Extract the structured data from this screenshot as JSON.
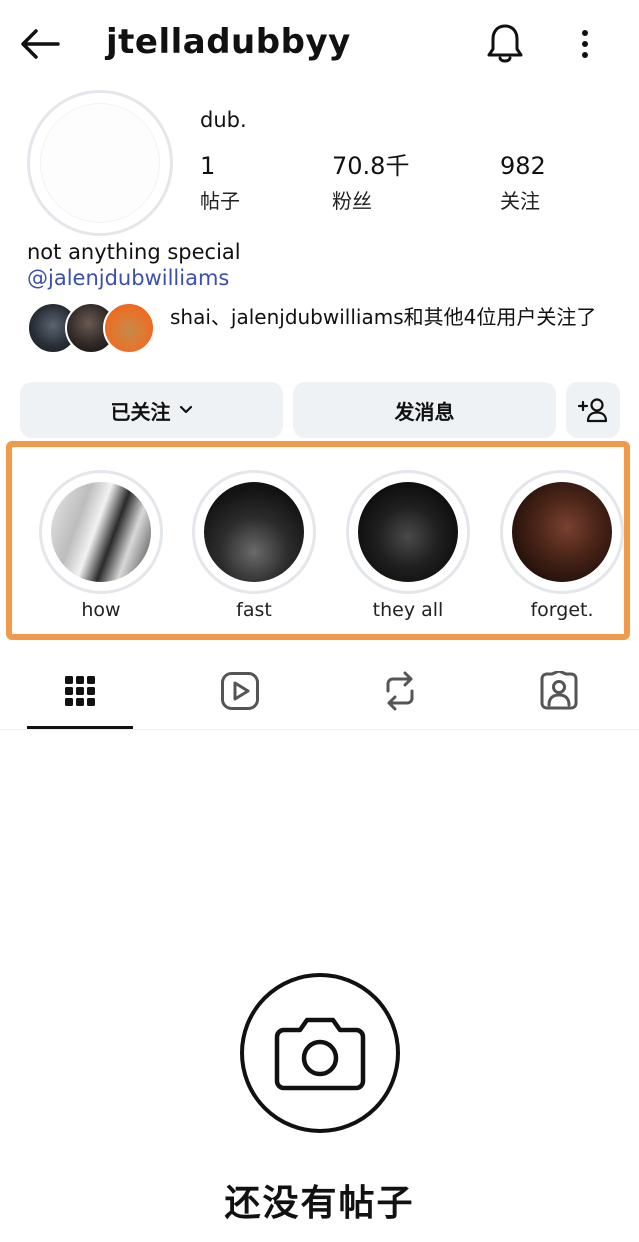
{
  "header": {
    "username": "jtelladubbyy",
    "back_icon": "arrow-left-icon",
    "notification_icon": "bell-icon",
    "more_icon": "more-vertical-icon"
  },
  "profile": {
    "display_name": "dub.",
    "bio": "not anything special",
    "link": "@jalenjdubwilliams",
    "stats": [
      {
        "value": "1",
        "label": "帖子"
      },
      {
        "value": "70.8千",
        "label": "粉丝"
      },
      {
        "value": "982",
        "label": "关注"
      }
    ],
    "mutual_text": "shai、jalenjdubwilliams和其他4位用户关注了"
  },
  "actions": {
    "following_label": "已关注",
    "message_label": "发消息",
    "add_friend_icon": "add-person-icon"
  },
  "highlights": [
    {
      "label": "how"
    },
    {
      "label": "fast"
    },
    {
      "label": "they all"
    },
    {
      "label": "forget."
    }
  ],
  "tabs": [
    {
      "name": "posts",
      "icon": "grid-icon",
      "active": true
    },
    {
      "name": "reels",
      "icon": "play-icon",
      "active": false
    },
    {
      "name": "reposts",
      "icon": "repost-icon",
      "active": false
    },
    {
      "name": "tagged",
      "icon": "tagged-person-icon",
      "active": false
    }
  ],
  "empty_state": {
    "title": "还没有帖子",
    "icon": "camera-icon"
  },
  "colors": {
    "highlight_border": "#f39a4a",
    "link": "#3b4fae",
    "button_bg": "#eff2f5"
  }
}
